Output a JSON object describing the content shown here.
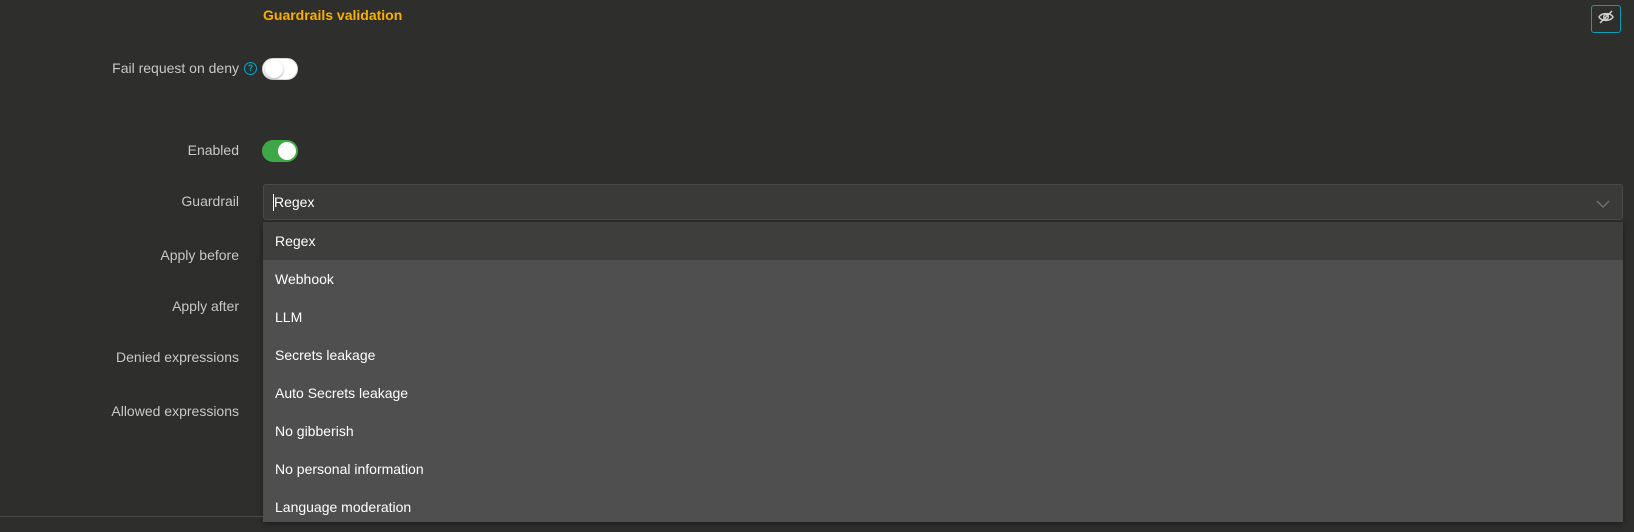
{
  "section": {
    "title": "Guardrails validation",
    "hide_button_icon": "eye-slash-icon"
  },
  "fields": {
    "fail_request_on_deny": {
      "label": "Fail request on deny",
      "help_icon": "?",
      "enabled": false
    },
    "enabled": {
      "label": "Enabled",
      "enabled": true
    },
    "guardrail": {
      "label": "Guardrail",
      "value": "Regex"
    },
    "apply_before": {
      "label": "Apply before"
    },
    "apply_after": {
      "label": "Apply after"
    },
    "denied_expressions": {
      "label": "Denied expressions"
    },
    "allowed_expressions": {
      "label": "Allowed expressions"
    }
  },
  "dropdown": {
    "options": [
      "Regex",
      "Webhook",
      "LLM",
      "Secrets leakage",
      "Auto Secrets leakage",
      "No gibberish",
      "No personal information",
      "Language moderation"
    ],
    "selected": "Regex"
  },
  "colors": {
    "accent_title": "#f9b000",
    "toggle_on": "#3da845",
    "hide_button_border": "#0a9fb8",
    "help_icon": "#0aa4c8"
  }
}
